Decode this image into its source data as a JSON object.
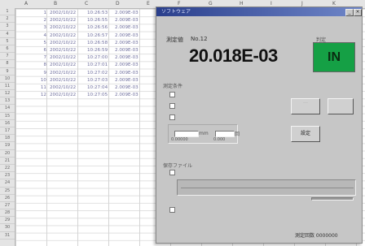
{
  "spreadsheet": {
    "columns": [
      "A",
      "B",
      "C",
      "D",
      "E",
      "F",
      "G",
      "H",
      "I",
      "J",
      "K"
    ],
    "row_numbers": [
      "1",
      "2",
      "3",
      "4",
      "5",
      "6",
      "7",
      "8",
      "9",
      "10",
      "11",
      "12",
      "13",
      "14",
      "15",
      "16",
      "17",
      "18",
      "19",
      "20",
      "21",
      "22",
      "23",
      "24",
      "25",
      "26",
      "27",
      "28",
      "29",
      "30",
      "31"
    ],
    "rows": [
      {
        "idx": "1",
        "date": "2002/10/22",
        "time": "10:26:53",
        "value": "2.009E-03"
      },
      {
        "idx": "2",
        "date": "2002/10/22",
        "time": "10:26:55",
        "value": "2.009E-03"
      },
      {
        "idx": "3",
        "date": "2002/10/22",
        "time": "10:26:56",
        "value": "2.009E-03"
      },
      {
        "idx": "4",
        "date": "2002/10/22",
        "time": "10:26:57",
        "value": "2.009E-03"
      },
      {
        "idx": "5",
        "date": "2002/10/22",
        "time": "10:26:58",
        "value": "2.009E-03"
      },
      {
        "idx": "6",
        "date": "2002/10/22",
        "time": "10:26:59",
        "value": "2.009E-03"
      },
      {
        "idx": "7",
        "date": "2002/10/22",
        "time": "10:27:00",
        "value": "2.009E-03"
      },
      {
        "idx": "8",
        "date": "2002/10/22",
        "time": "10:27:01",
        "value": "2.009E-03"
      },
      {
        "idx": "9",
        "date": "2002/10/22",
        "time": "10:27:02",
        "value": "2.009E-03"
      },
      {
        "idx": "10",
        "date": "2002/10/22",
        "time": "10:27:03",
        "value": "2.009E-03"
      },
      {
        "idx": "11",
        "date": "2002/10/22",
        "time": "10:27:04",
        "value": "2.009E-03"
      },
      {
        "idx": "12",
        "date": "2002/10/22",
        "time": "10:27:05",
        "value": "2.009E-03"
      }
    ]
  },
  "dialog": {
    "title": "ソフトウェア",
    "measure_label": "測定値",
    "measure_no": "No.12",
    "measured_value": "20.018E-03",
    "judgement_label": "判定",
    "judgement": "IN",
    "judgement_color": "#15a045",
    "settings_label": "測定条件",
    "upper_unit": "mm",
    "lower_unit": "回",
    "upper_value": "0.00000",
    "lower_value": "0.000",
    "file_label": "保存ファイル",
    "apply_label": "設定",
    "status_text": "測定回数 0000000"
  }
}
